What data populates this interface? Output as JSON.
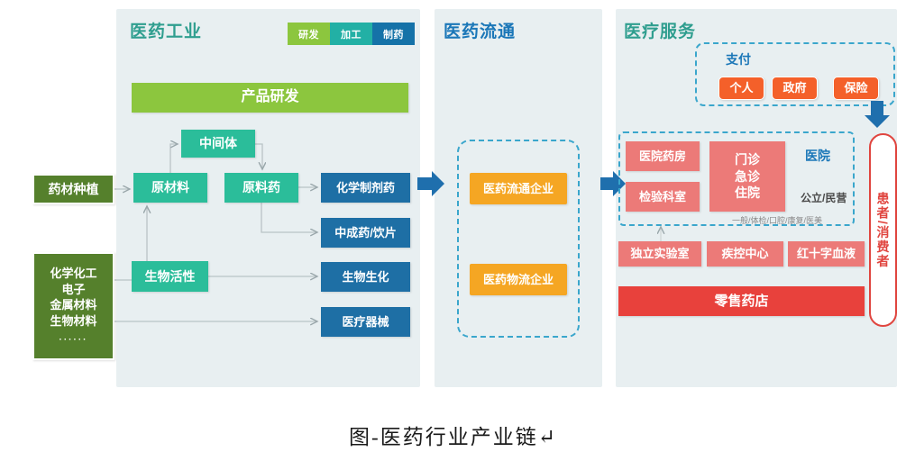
{
  "caption": "图-医药行业产业链↵",
  "legend": {
    "tags": [
      {
        "label": "研发",
        "color": "#8cc63e"
      },
      {
        "label": "加工",
        "color": "#22b0a5"
      },
      {
        "label": "制药",
        "color": "#1572a8"
      }
    ]
  },
  "sections": {
    "industry": {
      "title": "医药工业",
      "product_rd": "产品研发",
      "intermediate": "中间体",
      "raw_material": "原材料",
      "api": "原料药",
      "bioactive": "生物活性",
      "outputs": [
        {
          "label": "化学制剂药"
        },
        {
          "label": "中成药/饮片"
        },
        {
          "label": "生物生化"
        },
        {
          "label": "医疗器械"
        }
      ]
    },
    "circulation": {
      "title": "医药流通",
      "distribution_company": "医药流通企业",
      "logistics_company": "医药物流企业"
    },
    "service": {
      "title": "医疗服务",
      "payment": {
        "label": "支付",
        "payers": [
          {
            "label": "个人"
          },
          {
            "label": "政府"
          },
          {
            "label": "保险"
          }
        ]
      },
      "hospital": {
        "label": "医院",
        "ownership": "公立/民营",
        "subtypes": "一般/体检/口腔/康复/医美",
        "pharmacy": "医院药房",
        "lab": "检验科室",
        "departments": [
          "门诊",
          "急诊",
          "住院"
        ]
      },
      "others": [
        {
          "label": "独立实验室"
        },
        {
          "label": "疾控中心"
        },
        {
          "label": "红十字血液"
        }
      ],
      "retail": "零售药店",
      "patient": "患者/消费者"
    }
  },
  "upstream": {
    "herb_farming": "药材种植",
    "materials": {
      "lines": [
        "化学化工",
        "电子",
        "金属材料",
        "生物材料"
      ],
      "more": "······"
    }
  },
  "colors": {
    "panel_bg": "#e8eff1",
    "green": "#8cc63e",
    "teal": "#2bbd9a",
    "blue": "#1e6fa5",
    "olive": "#55802c",
    "orange": "#f5a623",
    "coral": "#f4602a",
    "salmon": "#ec7a78",
    "red": "#e8413c",
    "dashed_border": "#3aa6cc",
    "patient_outline": "#e0453f",
    "arrow": "#1f6fad",
    "connector": "#b9c3c6"
  }
}
